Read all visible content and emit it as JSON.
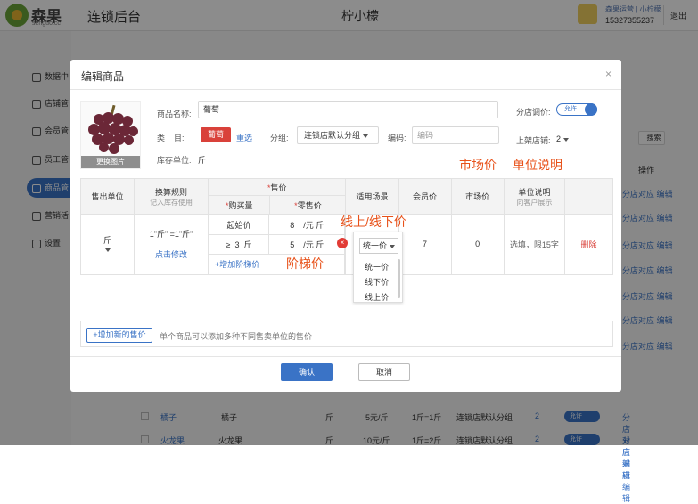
{
  "header": {
    "brand": "森果",
    "brand_sub": "senguo.cc",
    "app_title": "连锁后台",
    "store_title": "柠小檬",
    "user_line1": "森果运营 | 小柠檬",
    "user_phone": "15327355237",
    "logout": "退出"
  },
  "sidebar": {
    "items": [
      {
        "label": "数据中",
        "icon": "chart-icon"
      },
      {
        "label": "店铺管",
        "icon": "store-icon"
      },
      {
        "label": "会员管",
        "icon": "member-icon"
      },
      {
        "label": "员工管",
        "icon": "staff-icon"
      },
      {
        "label": "商品管",
        "icon": "goods-icon",
        "active": true
      },
      {
        "label": "营销活",
        "icon": "marketing-icon"
      },
      {
        "label": "设置",
        "icon": "settings-icon"
      }
    ]
  },
  "background": {
    "search_button": "搜索",
    "ops_header": "操作",
    "rows": [
      {
        "right": "分店对应  编辑"
      },
      {
        "right": "分店对应  编辑"
      },
      {
        "right": "分店对应  编辑"
      },
      {
        "right": "分店对应  编辑"
      },
      {
        "right": "分店对应  编辑"
      },
      {
        "right": "分店对应  编辑"
      },
      {
        "right": "分店对应  编辑"
      }
    ],
    "row_orange": {
      "name": "橘子",
      "name2": "橘子",
      "unit": "斤",
      "price": "5元/斤",
      "ratio": "1斤=1斤",
      "group": "连锁店默认分组",
      "num": "2",
      "toggle": "允许",
      "ops": "分店对应  编辑"
    },
    "row_dragon": {
      "name": "火龙果",
      "name2": "火龙果",
      "unit": "斤",
      "price": "10元/斤",
      "ratio": "1斤=2斤",
      "group": "连锁店默认分组",
      "num": "2",
      "toggle": "允许",
      "ops": "分店对应  编辑"
    }
  },
  "modal": {
    "title": "编辑商品",
    "close": "×",
    "change_image": "更换图片",
    "name_label": "商品名称:",
    "name_value": "葡萄",
    "category_label": "类    目:",
    "category_tag": "葡萄",
    "reselect": "重选",
    "group_label": "分组:",
    "group_value": "连锁店默认分组",
    "code_label": "编码:",
    "code_placeholder": "编码",
    "stock_unit_label": "库存单位:",
    "stock_unit_value": "斤",
    "store_adjust_label": "分店调价:",
    "store_adjust_toggle": "允许",
    "store_count_label": "上架店铺:",
    "store_count_value": "2",
    "annotations": {
      "market_price": "市场价",
      "unit_desc": "单位说明",
      "online_offline": "线上/线下价",
      "tier_price": "阶梯价"
    },
    "table": {
      "headers": {
        "sell_unit": "售出单位",
        "conversion": "换算规则",
        "conversion_sub": "记入库存使用",
        "price": "售价",
        "qty": "购买量",
        "retail": "零售价",
        "scene": "适用场景",
        "member": "会员价",
        "market": "市场价",
        "unit_desc": "单位说明",
        "unit_desc_sub": "向客户展示"
      },
      "row": {
        "unit": "斤",
        "conversion": "1\"斤\" =1\"斤\"",
        "modify": "点击修改",
        "tier1_qty": "起始价",
        "tier1_price": "8",
        "tier1_unit": "/元 斤",
        "tier2_op": "≥",
        "tier2_qty": "3",
        "tier2_qty_unit": "斤",
        "tier2_price": "5",
        "tier2_unit": "/元 斤",
        "add_tier": "+增加阶梯价",
        "scene": "统一价",
        "member": "7",
        "market": "0",
        "unit_desc": "选填，限15字",
        "delete": "删除"
      }
    },
    "scene_options": [
      "统一价",
      "线下价",
      "线上价"
    ],
    "add_price_button": "+增加新的售价",
    "add_price_hint": "单个商品可以添加多种不同售卖单位的售价",
    "confirm": "确认",
    "cancel": "取消"
  }
}
